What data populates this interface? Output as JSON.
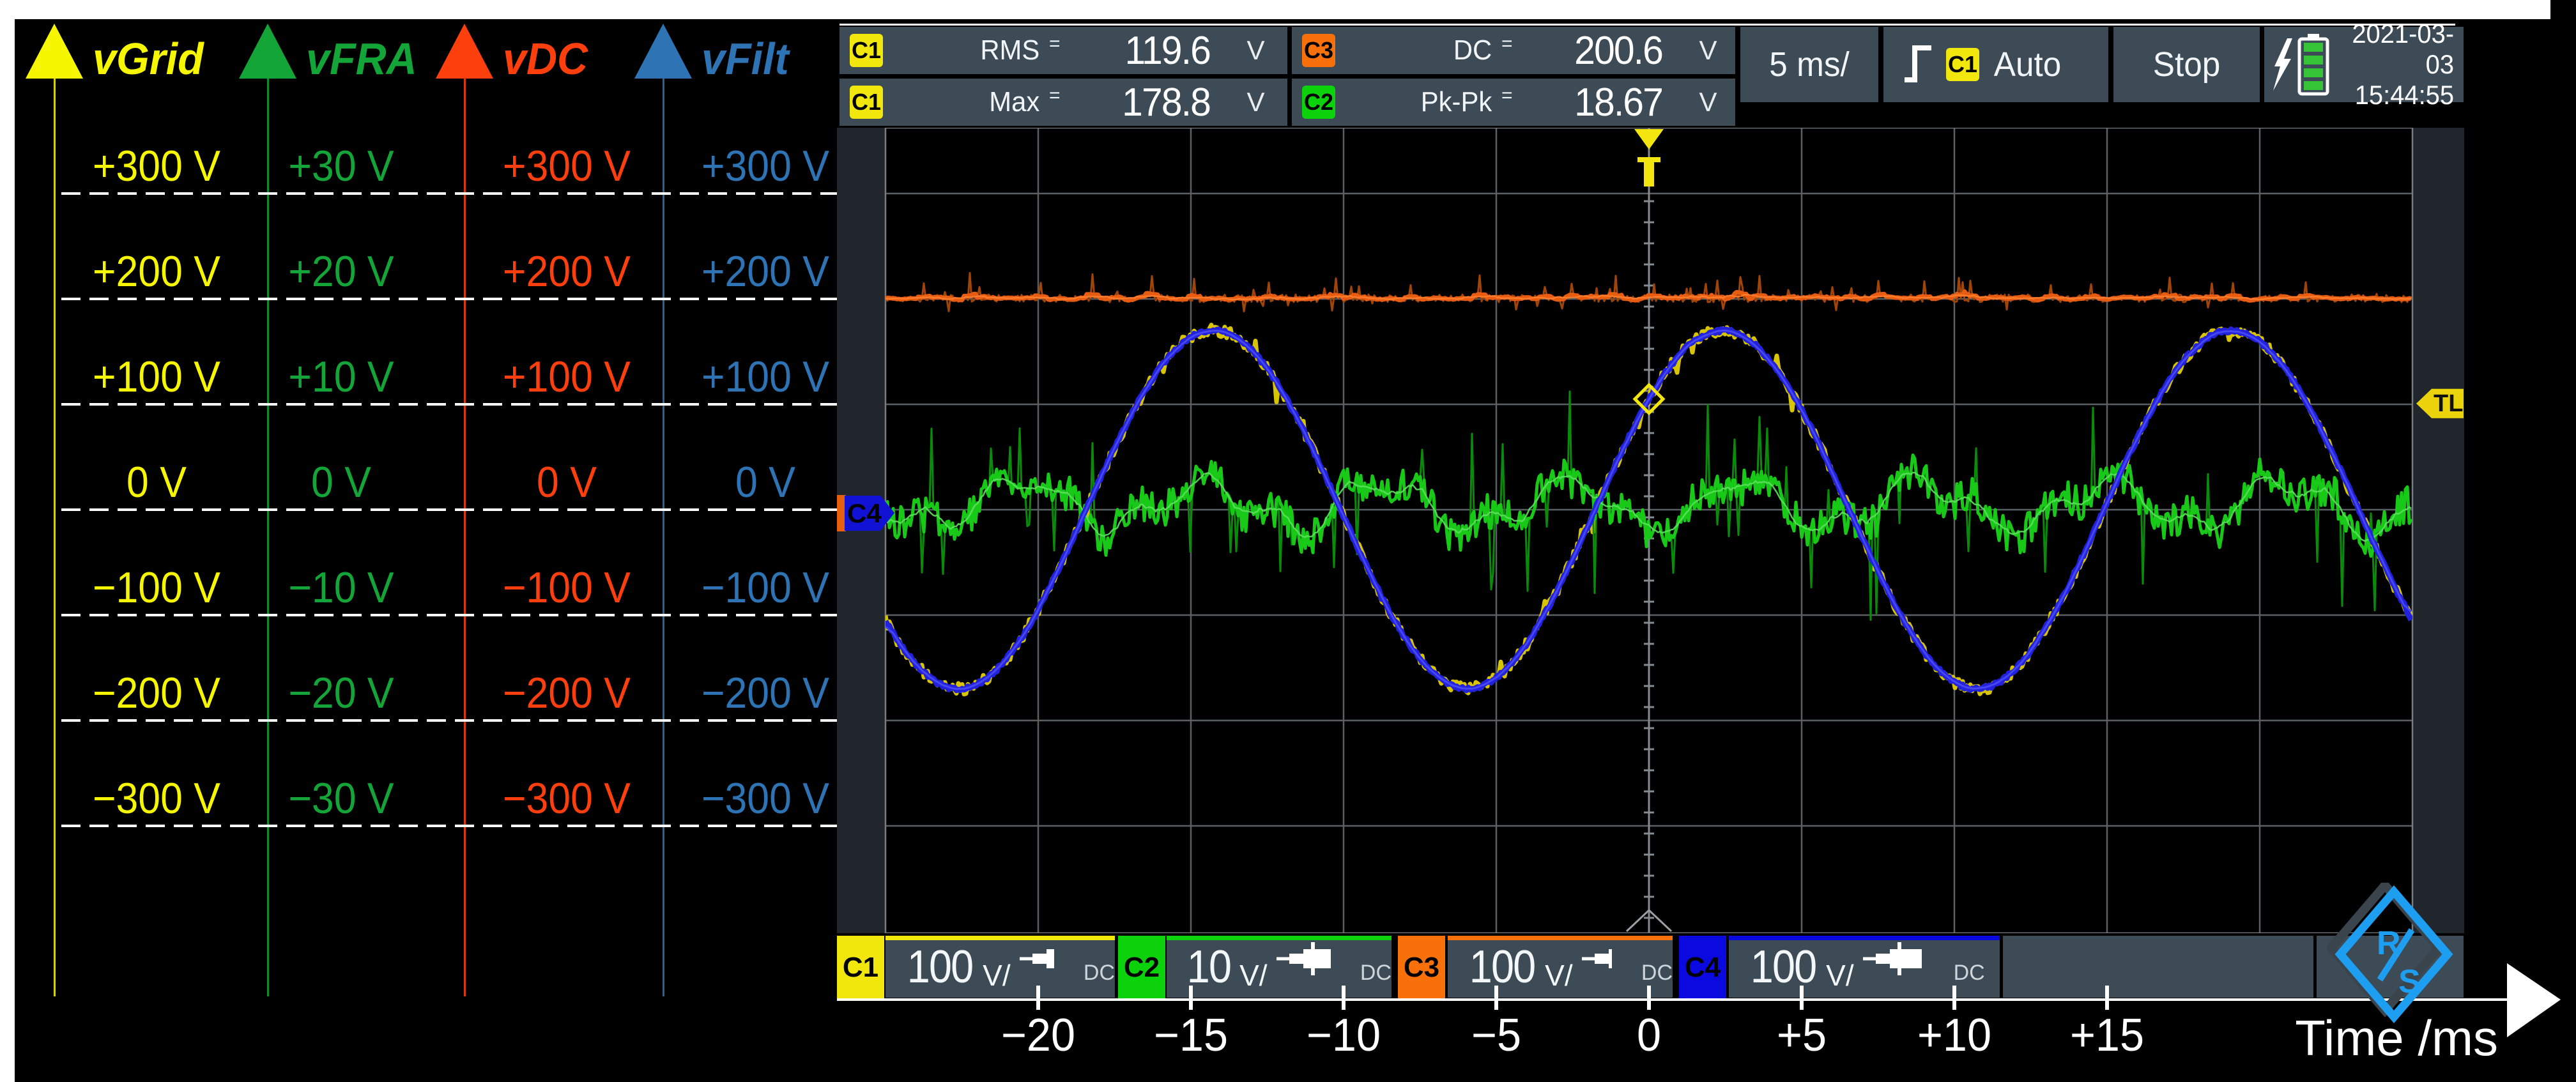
{
  "frame": {
    "bg": "#000000",
    "border": "#ffffff"
  },
  "channels": [
    {
      "id": "C1",
      "name": "vGrid",
      "label_color": "#f6f600",
      "badge_color": "#f2e70c",
      "tab_color": "#f2e70c",
      "scale_labels": [
        "+300 V",
        "+200 V",
        "+100 V",
        "0 V",
        "−100 V",
        "−200 V",
        "−300 V"
      ],
      "setting": {
        "scale": "100",
        "unit": "V/",
        "coupling": "DC"
      }
    },
    {
      "id": "C2",
      "name": "vFRA",
      "label_color": "#13a538",
      "badge_color": "#0bd20b",
      "tab_color": "#0bd20b",
      "scale_labels": [
        "+30 V",
        "+20 V",
        "+10 V",
        "0 V",
        "−10 V",
        "−20 V",
        "−30 V"
      ],
      "setting": {
        "scale": "10",
        "unit": "V/",
        "coupling": "DC"
      }
    },
    {
      "id": "C3",
      "name": "vDC",
      "label_color": "#fd3f0e",
      "badge_color": "#f8700a",
      "tab_color": "#f8700a",
      "scale_labels": [
        "+300 V",
        "+200 V",
        "+100 V",
        "0 V",
        "−100 V",
        "−200 V",
        "−300 V"
      ],
      "setting": {
        "scale": "100",
        "unit": "V/",
        "coupling": "DC"
      }
    },
    {
      "id": "C4",
      "name": "vFilt",
      "label_color": "#2e74b5",
      "badge_color": "#1414d2",
      "tab_color": "#0a0ae0",
      "scale_labels": [
        "+300 V",
        "+200 V",
        "+100 V",
        "0 V",
        "−100 V",
        "−200 V",
        "−300 V"
      ],
      "setting": {
        "scale": "100",
        "unit": "V/",
        "coupling": "DC"
      }
    }
  ],
  "measurements": {
    "groups": [
      {
        "rows": [
          {
            "source": "C1",
            "label": "RMS",
            "equals": "=",
            "value": "119.6",
            "unit": "V"
          },
          {
            "source": "C1",
            "label": "Max",
            "equals": "=",
            "value": "178.8",
            "unit": "V"
          }
        ]
      },
      {
        "rows": [
          {
            "source": "C3",
            "label": "DC",
            "equals": "=",
            "value": "200.6",
            "unit": "V"
          },
          {
            "source": "C2",
            "label": "Pk-Pk",
            "equals": "=",
            "value": "18.67",
            "unit": "V"
          }
        ]
      }
    ]
  },
  "timebase": {
    "label": "5 ms/"
  },
  "trigger": {
    "source": "C1",
    "mode_label": "Auto",
    "slope": "rising",
    "marker_top": "T",
    "marker_level": "TL"
  },
  "acquisition": {
    "state": "Stop"
  },
  "battery": {
    "charging": true,
    "segments": 4
  },
  "datetime": {
    "date": "2021-03-03",
    "time": "15:44:55"
  },
  "time_axis": {
    "ticks": [
      "−20",
      "−15",
      "−10",
      "−5",
      "0",
      "+5",
      "+10",
      "+15"
    ],
    "title": "Time /ms"
  },
  "logo": {
    "letters": "RS"
  },
  "chart_data": {
    "type": "line",
    "xlabel": "Time /ms",
    "time_per_div_ms": 5,
    "x_range_ms": [
      -26,
      25.6
    ],
    "x_ticks_ms": [
      -20,
      -15,
      -10,
      -5,
      0,
      5,
      10,
      15
    ],
    "grid": true,
    "series": [
      {
        "name": "vGrid",
        "channel": "C1",
        "color": "#d8c400",
        "volts_per_div": 100,
        "waveform": "sine_noisy",
        "frequency_hz": 60,
        "amplitude_v": 170,
        "offset_v": 0,
        "measured": {
          "RMS_V": 119.6,
          "Max_V": 178.8
        }
      },
      {
        "name": "vFRA",
        "channel": "C2",
        "color": "#1ec41e",
        "volts_per_div": 10,
        "waveform": "noise_band",
        "mean_v": 0.5,
        "measured": {
          "PkPk_V": 18.67
        }
      },
      {
        "name": "vDC",
        "channel": "C3",
        "color": "#ee6311",
        "volts_per_div": 100,
        "waveform": "dc_noisy",
        "measured": {
          "DC_V": 200.6
        }
      },
      {
        "name": "vFilt",
        "channel": "C4",
        "color": "#2222dd",
        "volts_per_div": 100,
        "waveform": "sine",
        "frequency_hz": 60,
        "amplitude_v": 170,
        "offset_v": 0
      }
    ],
    "trigger": {
      "source": "C1",
      "slope": "rising",
      "mode": "Auto",
      "time_position_ms": 0,
      "level_v": 105
    }
  }
}
